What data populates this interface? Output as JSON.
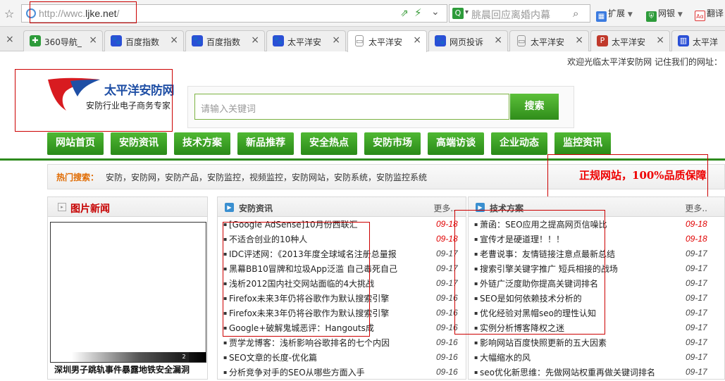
{
  "browser": {
    "url_prefix": "http://wwc.",
    "url_domain": "ljke.net",
    "url_suffix": "/",
    "search_placeholder": "朓晨回应离婚内幕",
    "toolbar": {
      "extend_label": "扩展",
      "netbank_label": "网银",
      "translate_label": "翻译"
    }
  },
  "tabs": [
    {
      "label": "360导航_",
      "icon": "360-icon",
      "color": "#2d9b3a",
      "active": false
    },
    {
      "label": "百度指数",
      "icon": "baidu-paw-icon",
      "color": "#2a4fd6",
      "active": false
    },
    {
      "label": "百度指数",
      "icon": "baidu-paw-icon",
      "color": "#2a4fd6",
      "active": false
    },
    {
      "label": "太平洋安",
      "icon": "baidu-paw-icon",
      "color": "#2a4fd6",
      "active": false
    },
    {
      "label": "太平洋安",
      "icon": "document-icon",
      "color": "#888888",
      "active": true
    },
    {
      "label": "网页投诉",
      "icon": "baidu-paw-icon",
      "color": "#2a4fd6",
      "active": false
    },
    {
      "label": "太平洋安",
      "icon": "document-icon",
      "color": "#888888",
      "active": false
    },
    {
      "label": "太平洋安",
      "icon": "pacific-logo-icon",
      "color": "#c0392b",
      "active": false
    },
    {
      "label": "太平洋",
      "icon": "chart-icon",
      "color": "#2a4fd6",
      "active": false
    }
  ],
  "page": {
    "welcome": "欢迎光临太平洋安防网  记住我们的网址：",
    "logo_name": "太平洋安防网",
    "logo_slogan": "安防行业电子商务专家",
    "search_placeholder": "请输入关键词",
    "search_button": "搜索",
    "nav": [
      "网站首页",
      "安防资讯",
      "技术方案",
      "新品推荐",
      "安全热点",
      "安防市场",
      "高端访谈",
      "企业动态",
      "监控资讯"
    ],
    "hot_label": "热门搜索：",
    "hot_items": "安防，安防网，安防产品，安防监控，视频监控，安防网站，安防系统，安防监控系统",
    "quality_banner": "正规网站，100%品质保障",
    "accent_green": "#2e8b1e",
    "date_red": "#e00000"
  },
  "picture_news": {
    "title": "图片新闻",
    "pager": "2",
    "caption": "深圳男子跳轨事件暴露地铁安全漏洞"
  },
  "news_panel": {
    "title": "安防资讯",
    "more": "更多..",
    "items": [
      {
        "title": "[Google AdSense]10月份西联汇",
        "date": "09-18",
        "red": true
      },
      {
        "title": "不适合创业的10种人",
        "date": "09-18",
        "red": true
      },
      {
        "title": "IDC评述网：《2013年度全球域名注册总量报",
        "date": "09-17",
        "red": false
      },
      {
        "title": "黑幕BB10冒牌和垃圾App泛滥 自己毒死自己",
        "date": "09-17",
        "red": false
      },
      {
        "title": "浅析2012国内社交网站面临的4大挑战",
        "date": "09-17",
        "red": false
      },
      {
        "title": "Firefox未来3年仍将谷歌作为默认搜索引擎",
        "date": "09-16",
        "red": false
      },
      {
        "title": "Firefox未来3年仍将谷歌作为默认搜索引擎",
        "date": "09-16",
        "red": false
      },
      {
        "title": "Google+破解鬼城恶评：Hangouts成",
        "date": "09-16",
        "red": false
      },
      {
        "title": "贾学龙博客：浅析影响谷歌排名的七个内因",
        "date": "09-16",
        "red": false
      },
      {
        "title": "SEO文章的长度-优化篇",
        "date": "09-16",
        "red": false
      },
      {
        "title": "分析竞争对手的SEO从哪些方面入手",
        "date": "09-16",
        "red": false
      }
    ]
  },
  "tech_panel": {
    "title": "技术方案",
    "more": "更多..",
    "items": [
      {
        "title": "萧函：SEO应用之提高网页信噪比",
        "date": "09-18",
        "red": true
      },
      {
        "title": "宣传才是硬道理！！！",
        "date": "09-18",
        "red": true
      },
      {
        "title": "老曹说事：友情链接注意点最新总结",
        "date": "09-17",
        "red": false
      },
      {
        "title": "搜索引擎关键字推广 短兵相接的战场",
        "date": "09-17",
        "red": false
      },
      {
        "title": "外链广泛度助你提高关键词排名",
        "date": "09-17",
        "red": false
      },
      {
        "title": "SEO是如何依赖技术分析的",
        "date": "09-17",
        "red": false
      },
      {
        "title": "优化经验对黑帽seo的理性认知",
        "date": "09-17",
        "red": false
      },
      {
        "title": "实例分析博客降权之迷",
        "date": "09-17",
        "red": false
      },
      {
        "title": "影响网站百度快照更新的五大因素",
        "date": "09-17",
        "red": false
      },
      {
        "title": "大幅缩水的风",
        "date": "09-17",
        "red": false
      },
      {
        "title": "seo优化新思维：先做网站权重再做关键词排名",
        "date": "09-17",
        "red": false
      }
    ]
  }
}
